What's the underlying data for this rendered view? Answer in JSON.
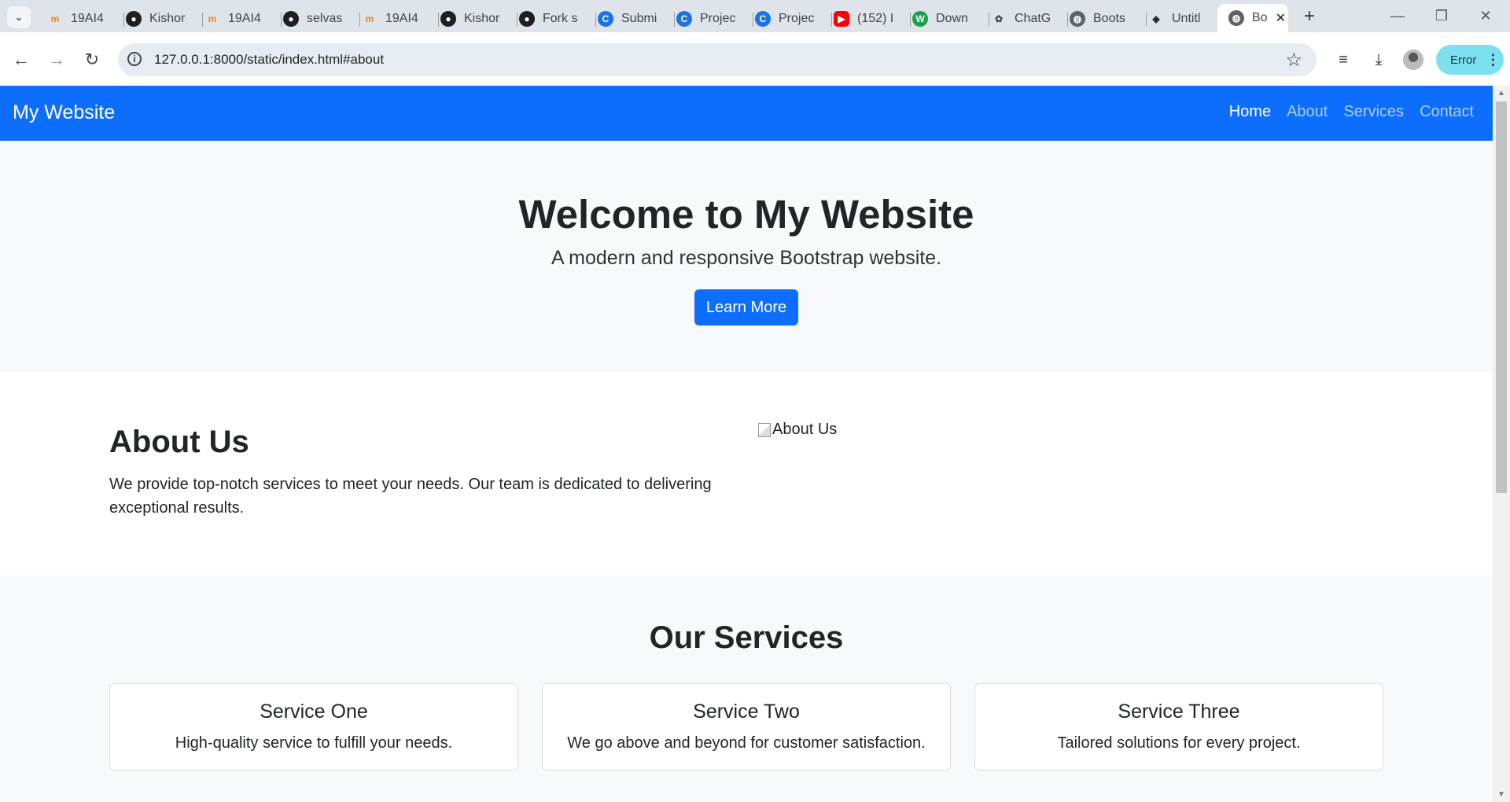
{
  "browser": {
    "tabs": [
      {
        "title": "19AI4",
        "icon": "moodle-icon",
        "color": "#f98012"
      },
      {
        "title": "Kishor",
        "icon": "github-icon",
        "color": "#1f1f1f"
      },
      {
        "title": "19AI4",
        "icon": "moodle-icon",
        "color": "#f98012"
      },
      {
        "title": "selvas",
        "icon": "github-icon",
        "color": "#1f1f1f"
      },
      {
        "title": "19AI4",
        "icon": "moodle-icon",
        "color": "#f98012"
      },
      {
        "title": "Kishor",
        "icon": "github-icon",
        "color": "#1f1f1f"
      },
      {
        "title": "Fork s",
        "icon": "github-icon",
        "color": "#1f1f1f"
      },
      {
        "title": "Submi",
        "icon": "c-circle-icon",
        "color": "#1a73e8"
      },
      {
        "title": "Projec",
        "icon": "c-circle-icon",
        "color": "#1a73e8"
      },
      {
        "title": "Projec",
        "icon": "c-circle-icon",
        "color": "#1a73e8"
      },
      {
        "title": "(152) I",
        "icon": "youtube-icon",
        "color": "#ff0000"
      },
      {
        "title": "Down",
        "icon": "w-circle-icon",
        "color": "#16a34a"
      },
      {
        "title": "ChatG",
        "icon": "chatgpt-icon",
        "color": "#444444"
      },
      {
        "title": "Boots",
        "icon": "globe-icon",
        "color": "#5f6368"
      },
      {
        "title": "Untitl",
        "icon": "codepen-icon",
        "color": "#1f1f1f"
      },
      {
        "title": "Bo",
        "icon": "globe-icon",
        "color": "#5f6368",
        "active": true
      }
    ],
    "url": "127.0.0.1:8000/static/index.html#about",
    "profile_status": "Error"
  },
  "site": {
    "brand": "My Website",
    "nav": [
      "Home",
      "About",
      "Services",
      "Contact"
    ],
    "hero": {
      "title": "Welcome to My Website",
      "subtitle": "A modern and responsive Bootstrap website.",
      "button": "Learn More"
    },
    "about": {
      "heading": "About Us",
      "text": "We provide top-notch services to meet your needs. Our team is dedicated to delivering exceptional results.",
      "image_alt": "About Us"
    },
    "services": {
      "heading": "Our Services",
      "cards": [
        {
          "title": "Service One",
          "text": "High-quality service to fulfill your needs."
        },
        {
          "title": "Service Two",
          "text": "We go above and beyond for customer satisfaction."
        },
        {
          "title": "Service Three",
          "text": "Tailored solutions for every project."
        }
      ]
    }
  },
  "colors": {
    "primary": "#0d6efd",
    "light_bg": "#f8f9fa",
    "error_pill": "#7ee0ee"
  }
}
